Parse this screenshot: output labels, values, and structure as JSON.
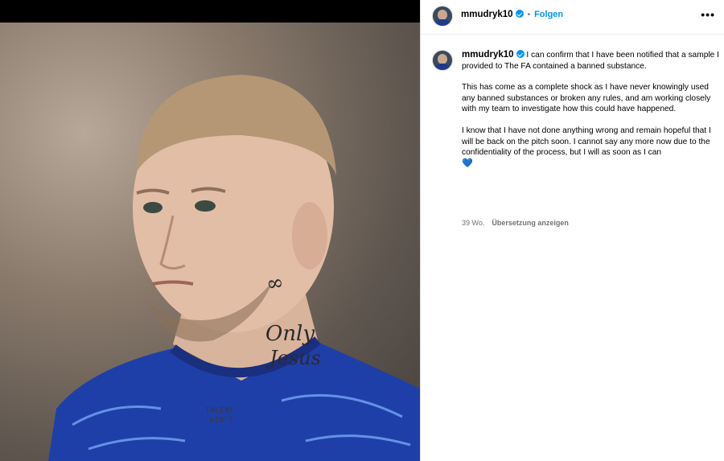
{
  "post": {
    "username": "mmudryk10",
    "separator": "•",
    "follow_label": "Folgen",
    "more_label": "•••"
  },
  "caption": {
    "username": "mmudryk10",
    "first_text": "I can confirm that I have been notified that a sample I provided to The FA contained a banned substance.",
    "paragraph2": "This has come as a complete shock as I have never knowingly used any banned substances or broken any rules, and am working closely with my team to investigate how this could have happened.",
    "paragraph3": "I know that I have not done anything wrong and remain hopeful that I will be back on the pitch soon. I cannot say any more now due to the confidentiality of the process, but I will as soon as I can",
    "emoji": "💙"
  },
  "meta": {
    "time_ago": "39 Wo.",
    "translate_label": "Übersetzung anzeigen"
  },
  "photo": {
    "tattoo_text_1": "Only",
    "tattoo_text_2": "Jesus",
    "tattoo_chest_1": "TALENT",
    "tattoo_chest_2": "AIN'T"
  },
  "colors": {
    "accent": "#0095f6",
    "jersey": "#1f3fa8",
    "heart": "#3b82f6"
  },
  "icons": {
    "verified": "verified-badge-icon",
    "more": "more-options-icon"
  }
}
